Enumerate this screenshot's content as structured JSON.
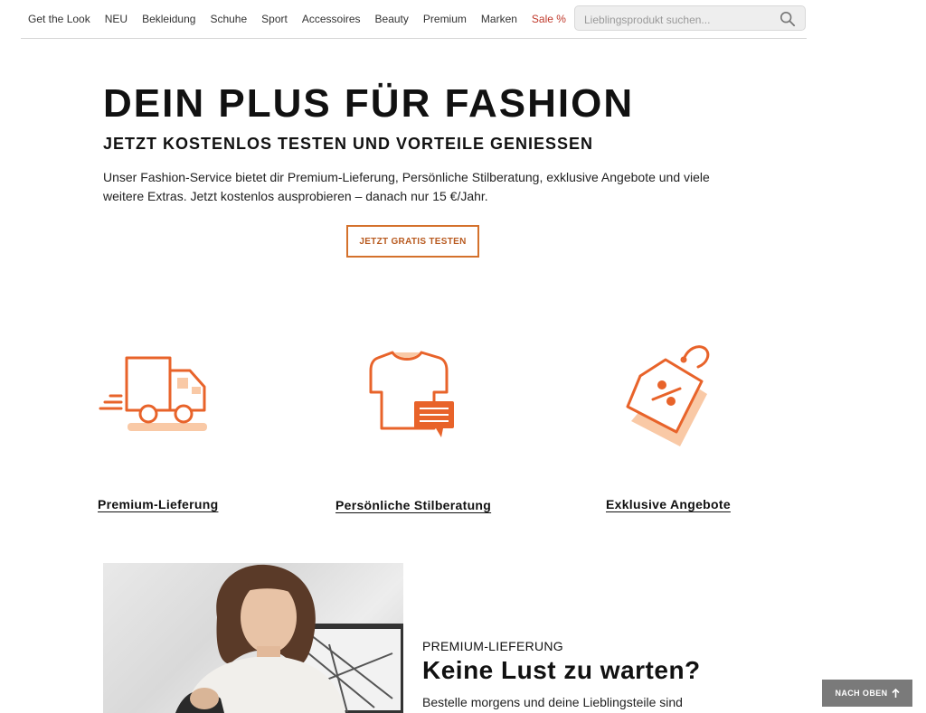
{
  "nav": {
    "items": [
      {
        "label": "Get the Look"
      },
      {
        "label": "NEU"
      },
      {
        "label": "Bekleidung"
      },
      {
        "label": "Schuhe"
      },
      {
        "label": "Sport"
      },
      {
        "label": "Accessoires"
      },
      {
        "label": "Beauty"
      },
      {
        "label": "Premium"
      },
      {
        "label": "Marken"
      },
      {
        "label": "Sale %"
      }
    ],
    "search": {
      "placeholder": "Lieblingsprodukt suchen...",
      "icon": "search-icon"
    }
  },
  "hero": {
    "title": "DEIN PLUS FÜR FASHION",
    "subtitle": "JETZT KOSTENLOS TESTEN UND VORTEILE GENIESSEN",
    "text": "Unser Fashion-Service bietet dir Premium-Lieferung, Persönliche Stilberatung, exklusive Angebote und viele weitere Extras. Jetzt kostenlos ausprobieren – danach nur 15 €/Jahr.",
    "cta_label": "JETZT GRATIS TESTEN"
  },
  "features": [
    {
      "label": "Premium-Lieferung",
      "icon": "delivery-truck-icon"
    },
    {
      "label": "Persönliche Stilberatung",
      "icon": "shirt-chat-icon"
    },
    {
      "label": "Exklusive Angebote",
      "icon": "discount-tag-icon"
    }
  ],
  "section": {
    "eyebrow": "PREMIUM-LIEFERUNG",
    "heading": "Keine Lust zu warten?",
    "text": "Bestelle morgens und deine Lieblingsteile sind"
  },
  "back_to_top": {
    "label": "NACH OBEN",
    "icon": "arrow-up-icon"
  },
  "colors": {
    "accent": "#e8632a",
    "accent_light": "#f9c9a6",
    "sale": "#c0392b",
    "back_to_top_bg": "#7a7a7a"
  }
}
